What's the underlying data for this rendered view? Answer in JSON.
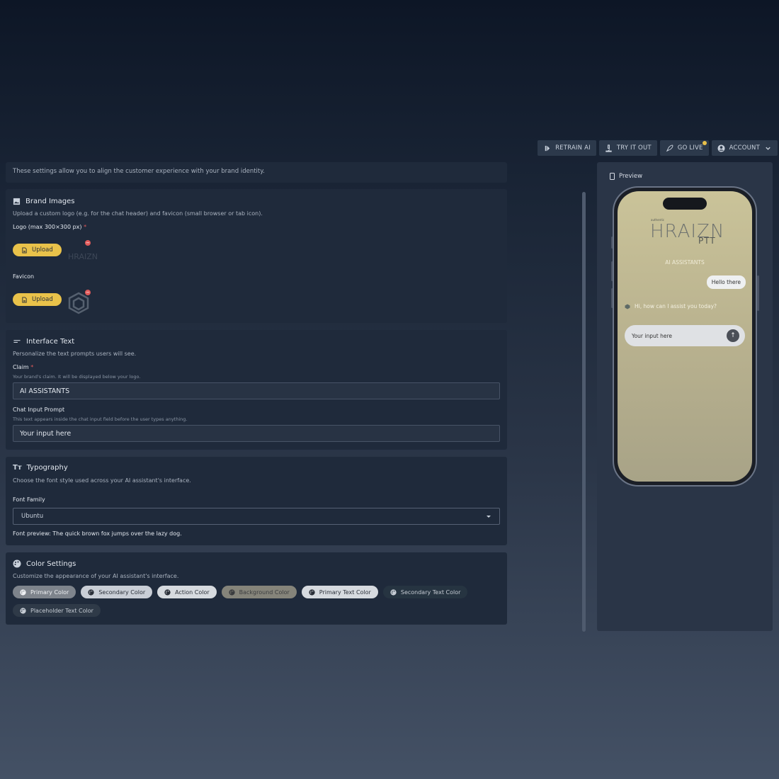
{
  "nav": {
    "retrain": "RETRAIN AI",
    "try": "TRY IT OUT",
    "golive": "GO LIVE",
    "account": "ACCOUNT"
  },
  "intro": {
    "desc": "These settings allow you to align the customer experience with your brand identity."
  },
  "brand": {
    "title": "Brand Images",
    "sub": "Upload a custom logo (e.g. for the chat header) and favicon (small browser or tab icon).",
    "logo_label": "Logo (max 300×300 px)",
    "upload": "Upload",
    "favicon_label": "Favicon"
  },
  "interface": {
    "title": "Interface Text",
    "sub": "Personalize the text prompts users will see.",
    "claim_label": "Claim",
    "claim_hint": "Your brand's claim. It will be displayed below your logo.",
    "claim_value": "AI ASSISTANTS",
    "prompt_label": "Chat Input Prompt",
    "prompt_hint": "This text appears inside the chat input field before the user types anything.",
    "prompt_value": "Your input here"
  },
  "typography": {
    "title": "Typography",
    "sub": "Choose the font style used across your AI assistant's interface.",
    "font_label": "Font Family",
    "font_value": "Ubuntu",
    "preview": "Font preview: The quick brown fox jumps over the lazy dog."
  },
  "colors": {
    "title": "Color Settings",
    "sub": "Customize the appearance of your AI assistant's interface.",
    "chips": [
      {
        "label": "Primary Color",
        "bg": "#7e848c",
        "fg": "#eef0f3"
      },
      {
        "label": "Secondary Color",
        "bg": "#c9ced6",
        "fg": "#2a2f38"
      },
      {
        "label": "Action Color",
        "bg": "#d6dadf",
        "fg": "#2a2f38"
      },
      {
        "label": "Background Color",
        "bg": "#85847a",
        "fg": "#3b3d3f"
      },
      {
        "label": "Primary Text Color",
        "bg": "#d6dadf",
        "fg": "#2a2f38"
      },
      {
        "label": "Secondary Text Color",
        "bg": "#263441",
        "fg": "#c6ccd4"
      },
      {
        "label": "Placeholder Text Color",
        "bg": "#2f3a48",
        "fg": "#c6ccd4"
      }
    ]
  },
  "preview": {
    "label": "Preview",
    "logo_small": "authentic",
    "logo_main": "HRAIZN",
    "logo_sub": "PTT",
    "claim": "AI ASSISTANTS",
    "user_msg": "Hello there",
    "bot_msg": "Hi, how can I assist you today?",
    "input_placeholder": "Your input here"
  }
}
